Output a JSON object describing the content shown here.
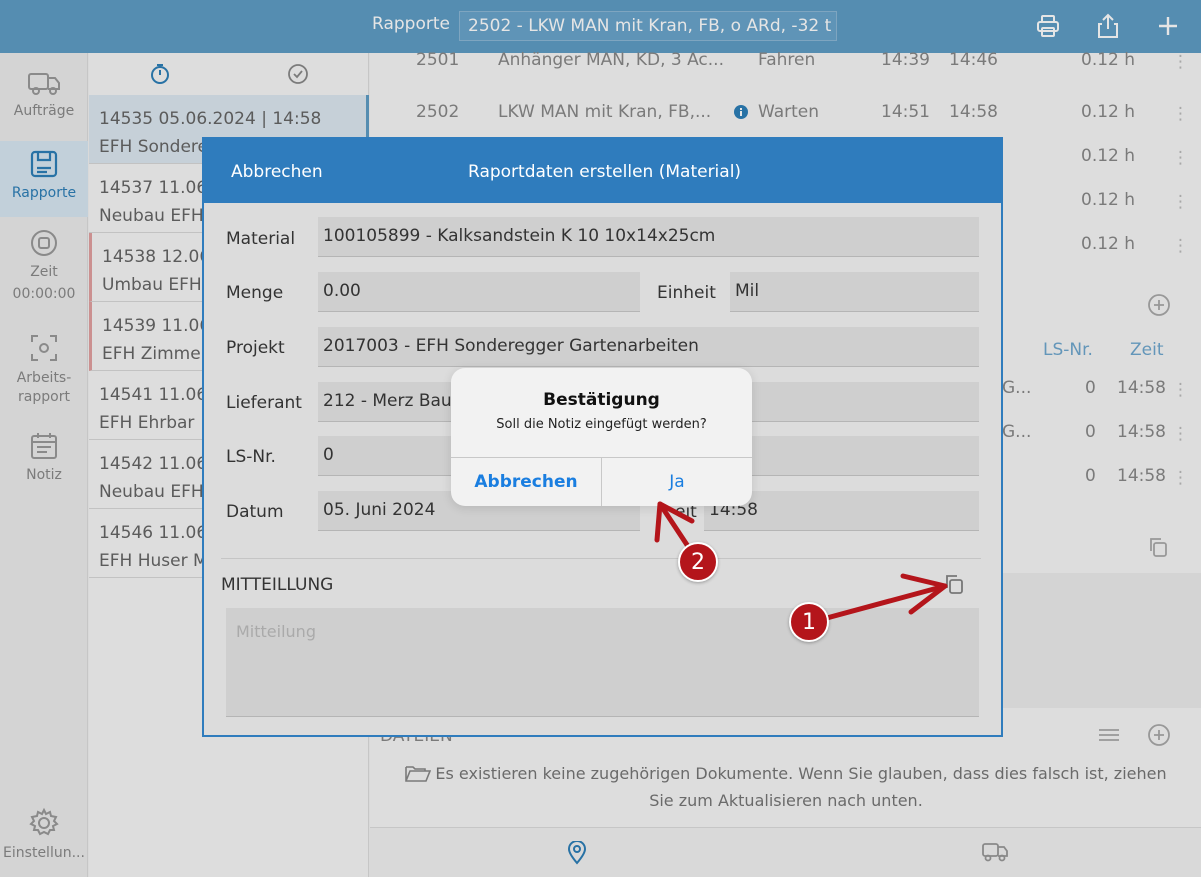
{
  "topbar": {
    "title": "Rapporte",
    "selector_value": "2502 - LKW MAN mit Kran, FB, o ARd, -32 t"
  },
  "leftnav": {
    "items": [
      {
        "label": "Aufträge",
        "icon": "truck-icon"
      },
      {
        "label": "Rapporte",
        "icon": "report-icon"
      },
      {
        "label": "Zeit",
        "icon": "stop-icon",
        "sub": "00:00:00"
      },
      {
        "label": "Arbeits-\nrapport",
        "icon": "scan-icon"
      },
      {
        "label": "Notiz",
        "icon": "calendar-icon"
      }
    ],
    "settings_label": "Einstellun..."
  },
  "list": {
    "items": [
      {
        "line1": "14535  05.06.2024 | 14:58",
        "line2": "EFH Sondere"
      },
      {
        "line1": "14537  11.06.",
        "line2": "Neubau EFH"
      },
      {
        "line1": "14538  12.06.",
        "line2": "Umbau EFH"
      },
      {
        "line1": "14539  11.06.",
        "line2": "EFH Zimmer"
      },
      {
        "line1": "14541  11.06.2",
        "line2": "EFH Ehrbar"
      },
      {
        "line1": "14542  11.06.",
        "line2": "Neubau EFH"
      },
      {
        "line1": "14546  11.06.",
        "line2": "EFH Huser M"
      }
    ]
  },
  "main": {
    "rows": [
      {
        "nr": "2501",
        "name": "Anhänger MAN, KD, 3 Ac...",
        "status": "Fahren",
        "from": "14:39",
        "to": "14:46",
        "dur": "0.12 h"
      },
      {
        "nr": "2502",
        "name": "LKW MAN mit Kran, FB,...",
        "status": "Warten",
        "from": "14:51",
        "to": "14:58",
        "dur": "0.12 h"
      },
      {
        "dur": "0.12 h"
      },
      {
        "dur": "0.12 h"
      },
      {
        "dur": "0.12 h"
      }
    ],
    "material_cols": {
      "ls_label": "LS-Nr.",
      "time_label": "Zeit"
    },
    "material_rows": [
      {
        "name": "G...",
        "ls": "0",
        "time": "14:58"
      },
      {
        "name": "G...",
        "ls": "0",
        "time": "14:58"
      },
      {
        "name": "",
        "ls": "0",
        "time": "14:58"
      }
    ],
    "files_label": "DATEIEN",
    "files_empty": "Es existieren keine zugehörigen Dokumente. Wenn Sie glauben, dass dies falsch ist, ziehen Sie zum Aktualisieren nach unten."
  },
  "modal": {
    "cancel": "Abbrechen",
    "title": "Raportdaten erstellen (Material)",
    "fields": {
      "material_label": "Material",
      "material_value": "100105899 - Kalksandstein K 10 10x14x25cm",
      "menge_label": "Menge",
      "menge_value": "0.00",
      "einheit_label": "Einheit",
      "einheit_value": "Mil",
      "projekt_label": "Projekt",
      "projekt_value": "2017003 - EFH Sonderegger Gartenarbeiten",
      "lieferant_label": "Lieferant",
      "lieferant_value": "212 - Merz Baus",
      "ls_label": "LS-Nr.",
      "ls_value": "0",
      "datum_label": "Datum",
      "datum_value": "05. Juni 2024",
      "zeit_label": "eit",
      "zeit_value": "14:58"
    },
    "mitteilung_label": "MITTEILLUNG",
    "mitteilung_placeholder": "Mitteilung"
  },
  "alert": {
    "title": "Bestätigung",
    "message": "Soll die Notiz eingefügt werden?",
    "cancel": "Abbrechen",
    "confirm": "Ja"
  },
  "annotations": {
    "badge1": "1",
    "badge2": "2"
  },
  "colors": {
    "topbar": "#5f9ec6",
    "modal_header": "#2f7cbd",
    "alert_button": "#1a7ee0",
    "annotation": "#b4151b"
  }
}
